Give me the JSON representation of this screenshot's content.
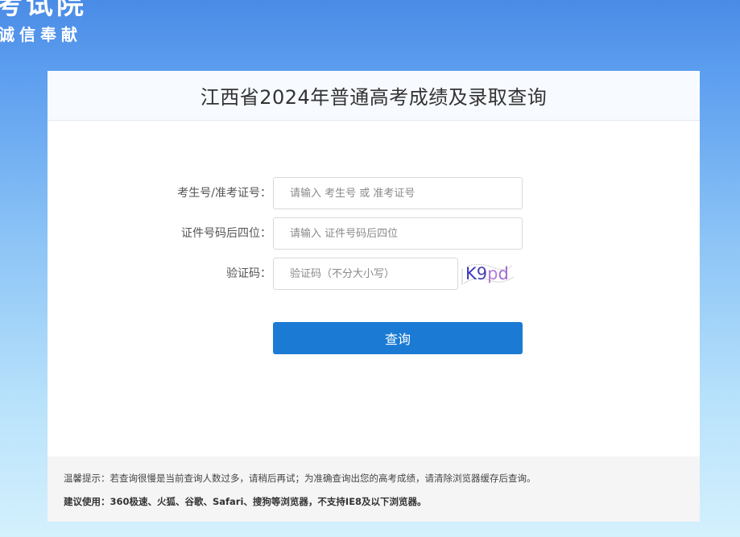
{
  "banner": {
    "title": "考试院",
    "subtitle": "诚信奉献"
  },
  "card": {
    "title": "江西省2024年普通高考成绩及录取查询"
  },
  "form": {
    "exam_id": {
      "label": "考生号/准考证号：",
      "value": "",
      "placeholder": "请输入 考生号 或 准考证号"
    },
    "id_last4": {
      "label": "证件号码后四位：",
      "value": "",
      "placeholder": "请输入 证件号码后四位"
    },
    "captcha": {
      "label": "验证码：",
      "value": "",
      "placeholder": "验证码（不分大小写）",
      "image_text": "K9pd"
    },
    "submit_label": "查询"
  },
  "tips": {
    "line1": "温馨提示：若查询很慢是当前查询人数过多，请稍后再试；为准确查询出您的高考成绩，请清除浏览器缓存后查询。",
    "line2": "建议使用：360极速、火狐、谷歌、Safari、搜狗等浏览器，不支持IE8及以下浏览器。"
  },
  "colors": {
    "primary_button": "#1b7bd4",
    "header_background": "#f7fafe",
    "page_gradient_top": "#4a8be6",
    "page_gradient_bottom": "#d4f0fd"
  }
}
